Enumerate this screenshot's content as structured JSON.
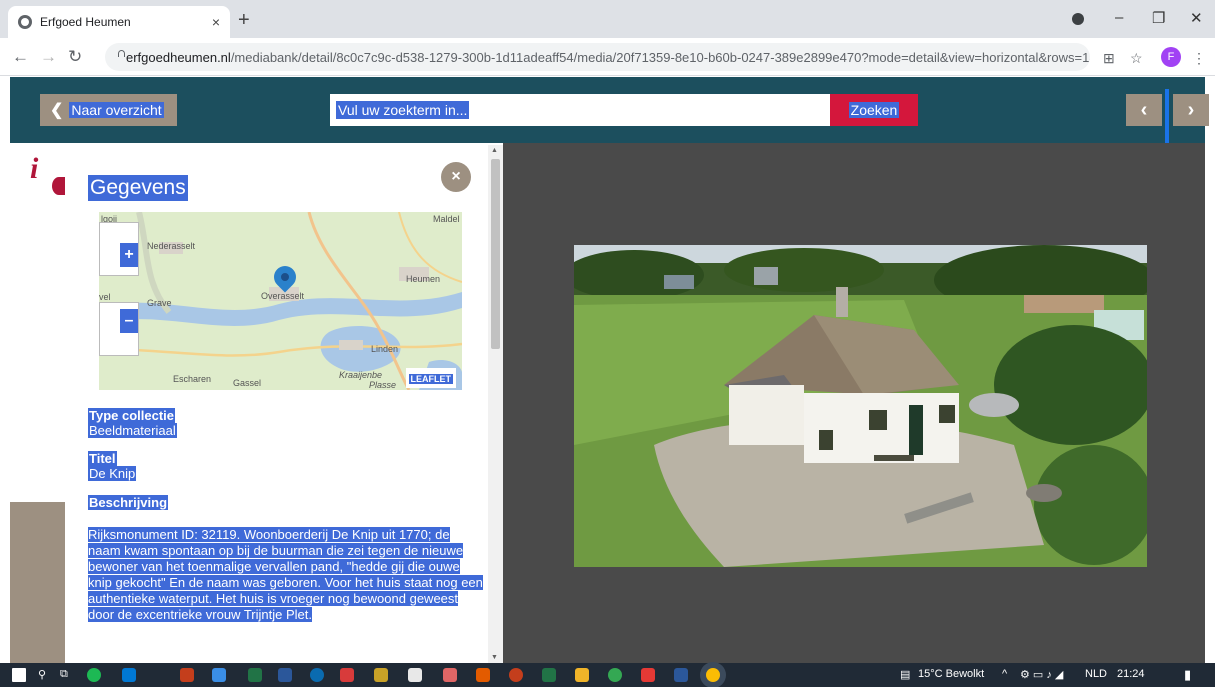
{
  "browser": {
    "tab_title": "Erfgoed Heumen",
    "tab_close": "×",
    "new_tab": "+",
    "url_host": "erfgoedheumen.nl",
    "url_path": "/mediabank/detail/8c0c7c9c-d538-1279-300b-1d11adeaff54/media/20f71359-8e10-b60b-0247-389e2899e470?mode=detail&view=horizontal&rows=1&...",
    "profile_initial": "F",
    "window_controls": [
      "–",
      "❐",
      "✕"
    ]
  },
  "toolbar": {
    "back_label": "Naar overzicht",
    "search_placeholder": "Vul uw zoekterm in...",
    "search_button": "Zoeken"
  },
  "panel": {
    "title": "Gegevens",
    "close": "×",
    "map": {
      "labels": [
        "lgoij",
        "Maldel",
        "Nederasselt",
        "Heumen",
        "Grave",
        "Overasselt",
        "Linden",
        "Escharen",
        "Gassel",
        "Kraaijenbe",
        "Plasse",
        "vel"
      ],
      "attribution": "LEAFLET",
      "zoom_in": "+",
      "zoom_out": "–"
    },
    "fields": [
      {
        "label": "Type collectie",
        "value": "Beeldmateriaal"
      },
      {
        "label": "Titel",
        "value": "De Knip"
      },
      {
        "label": "Beschrijving",
        "value": ""
      }
    ],
    "description": "Rijksmonument ID: 32119. Woonboerderij De Knip uit 1770; de naam kwam spontaan op bij de buurman die zei tegen de nieuwe bewoner van het toenmalige vervallen pand, \"hedde gij die ouwe knip gekocht\" En de naam was geboren. Voor het huis staat nog een authentieke waterput. Het huis is vroeger nog bewoond geweest door de excentrieke vrouw Trijntje Plet."
  },
  "taskbar": {
    "weather": "15°C  Bewolkt",
    "language": "NLD",
    "time": "21:24"
  },
  "colors": {
    "topbar": "#1c4f5e",
    "accent_red": "#d4173c",
    "taupe": "#9d9081",
    "selection": "#3f6ad8"
  }
}
